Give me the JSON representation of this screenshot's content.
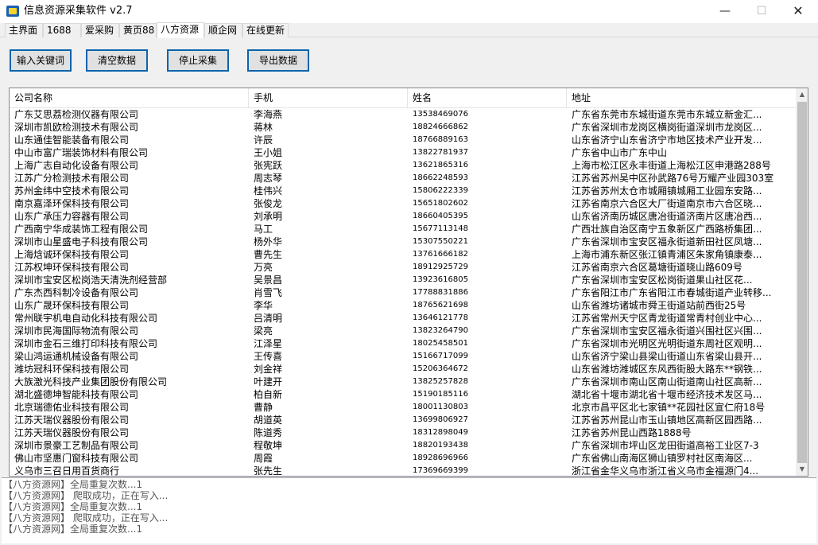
{
  "window": {
    "title": "信息资源采集软件 v2.7",
    "controls": {
      "minimize": "—",
      "maximize": "☐",
      "close": "✕"
    }
  },
  "tabs": [
    {
      "label": "主界面",
      "active": false
    },
    {
      "label": "1688",
      "active": false
    },
    {
      "label": "爱采购",
      "active": false
    },
    {
      "label": "黄页88",
      "active": false
    },
    {
      "label": "八方资源",
      "active": true
    },
    {
      "label": "顺企网",
      "active": false
    },
    {
      "label": "在线更新",
      "active": false
    }
  ],
  "toolbar": {
    "input_keywords": "输入关键词",
    "clear_data": "清空数据",
    "stop_collect": "停止采集",
    "export_data": "导出数据"
  },
  "table": {
    "columns": [
      "公司名称",
      "手机",
      "姓名",
      "地址"
    ],
    "rows": [
      [
        "广东艾思荔检测仪器有限公司",
        "李海燕",
        "13538469076",
        "广东省东莞市东城街道东莞市东城立新金汇..."
      ],
      [
        "深圳市凯欧检测技术有限公司",
        "蒋林",
        "18824666862",
        "广东省深圳市龙岗区横岗街道深圳市龙岗区..."
      ],
      [
        "山东通佳智能装备有限公司",
        "许辰",
        "18766889163",
        "山东省济宁山东省济宁市地区技术产业开发..."
      ],
      [
        "中山市富广瑞装饰材料有限公司",
        "王小姐",
        "13822781937",
        "广东省中山市广东中山"
      ],
      [
        "上海广志自动化设备有限公司",
        "张宪跃",
        "13621865316",
        "上海市松江区永丰街道上海松江区申港路288号"
      ],
      [
        "江苏广分检测技术有限公司",
        "周志琴",
        "18662248593",
        "江苏省苏州吴中区孙武路76号万耀产业园303室"
      ],
      [
        "苏州金纬中空技术有限公司",
        "桂伟兴",
        "15806222339",
        "江苏省苏州太仓市城厢镇城厢工业园东安路..."
      ],
      [
        "南京嘉泽环保科技有限公司",
        "张俊龙",
        "15651802602",
        "江苏省南京六合区大厂街道南京市六合区晓..."
      ],
      [
        "山东广承压力容器有限公司",
        "刘承明",
        "18660405395",
        "山东省济南历城区唐冶街道济南片区唐冶西..."
      ],
      [
        "广西南宁华成装饰工程有限公司",
        "马工",
        "15677113148",
        "广西壮族自治区南宁五象新区广西路桥集团..."
      ],
      [
        "深圳市山星盛电子科技有限公司",
        "杨外华",
        "15307550221",
        "广东省深圳市宝安区福永街道新田社区凤塘..."
      ],
      [
        "上海焓诚环保科技有限公司",
        "曹先生",
        "13761666182",
        "上海市浦东新区张江镇青浦区朱家角镇康泰..."
      ],
      [
        "江苏权坤环保科技有限公司",
        "万亮",
        "18912925729",
        "江苏省南京六合区葛塘街道晓山路609号"
      ],
      [
        "深圳市宝安区松岗浩天清洗剂经营部",
        "吴景昌",
        "13923616805",
        "广东省深圳市宝安区松岗街道果山社区花..."
      ],
      [
        "广东杰西科制冷设备有限公司",
        "肖雪飞",
        "17788831886",
        "广东省阳江市广东省阳江市春城街道产业转移..."
      ],
      [
        "山东广晟环保科技有限公司",
        "李华",
        "18765621698",
        "山东省潍坊诸城市舜王街道站前西街25号"
      ],
      [
        "常州联宇机电自动化科技有限公司",
        "吕清明",
        "13646121778",
        "江苏省常州天宁区青龙街道常青村创业中心..."
      ],
      [
        "深圳市民海国际物流有限公司",
        "梁亮",
        "13823264790",
        "广东省深圳市宝安区福永街道兴围社区兴围..."
      ],
      [
        "深圳市金石三维打印科技有限公司",
        "江泽星",
        "18025458501",
        "广东省深圳市光明区光明街道东周社区观明..."
      ],
      [
        "梁山鸿运通机械设备有限公司",
        "王传喜",
        "15166717099",
        "山东省济宁梁山县梁山街道山东省梁山县开..."
      ],
      [
        "潍坊冠科环保科技有限公司",
        "刘金祥",
        "15206364672",
        "山东省潍坊潍城区东风西街股大路东**钢铁..."
      ],
      [
        "大族激光科技产业集团股份有限公司",
        "叶建开",
        "13825257828",
        "广东省深圳市南山区南山街道南山社区高新..."
      ],
      [
        "湖北盛德坤智能科技有限公司",
        "柏自新",
        "15190185116",
        "湖北省十堰市湖北省十堰市经济技术发区马..."
      ],
      [
        "北京瑞德佑业科技有限公司",
        "曹静",
        "18001130803",
        "北京市昌平区北七家镇**花园社区宣仁府18号"
      ],
      [
        "江苏天瑞仪器股份有限公司",
        "胡道英",
        "13699806927",
        "江苏省苏州昆山市玉山镇地区高新区园西路..."
      ],
      [
        "江苏天瑞仪器股份有限公司",
        "陈道秀",
        "18312898049",
        "江苏省苏州昆山西路1888号"
      ],
      [
        "深圳市景豪工艺制品有限公司",
        "程敬坤",
        "18820193438",
        "广东省深圳市坪山区龙田街道高裕工业区7-3"
      ],
      [
        "佛山市坚惠门窗科技有限公司",
        "周霞",
        "18928696966",
        "广东省佛山南海区狮山镇罗村社区南海区..."
      ],
      [
        "义乌市三召日用百货商行",
        "张先生",
        "17369669399",
        "浙江省金华义乌市浙江省义乌市金福源门4..."
      ]
    ]
  },
  "log": [
    "【八方资源网】全局重复次数...1",
    "【八方资源网】 爬取成功，正在写入...",
    "【八方资源网】全局重复次数...1",
    "【八方资源网】 爬取成功，正在写入...",
    "【八方资源网】全局重复次数...1"
  ]
}
